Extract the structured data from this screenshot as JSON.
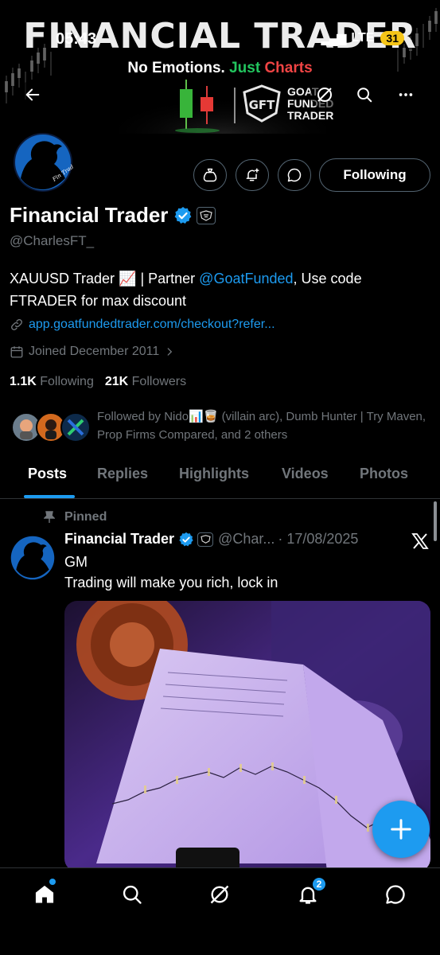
{
  "status_bar": {
    "time": "05:43",
    "network": "LTE",
    "battery": "31"
  },
  "banner": {
    "title": "FINANCIAL TRADER",
    "tagline_part1": "No Emotions.",
    "tagline_part2": "Just",
    "tagline_part3": "Charts",
    "brand_line1": "GOAT",
    "brand_line2": "FUNDED",
    "brand_line3": "TRADER",
    "brand_logo_text": "GFT"
  },
  "profile": {
    "display_name": "Financial Trader",
    "handle": "@CharlesFT_",
    "bio_part1": "XAUUSD Trader 📈 | Partner ",
    "bio_mention": "@GoatFunded",
    "bio_part2": ", Use code FTRADER for max discount",
    "website": "app.goatfundedtrader.com/checkout?refer...",
    "joined": "Joined December 2011",
    "following_count": "1.1K",
    "following_label": "Following",
    "followers_count": "21K",
    "followers_label": "Followers",
    "followed_by": "Followed by Nido📊🥃 (villain arc), Dumb Hunter | Try Maven, Prop Firms Compared, and 2 others",
    "following_button": "Following"
  },
  "tabs": [
    "Posts",
    "Replies",
    "Highlights",
    "Videos",
    "Photos"
  ],
  "pinned_post": {
    "pinned_label": "Pinned",
    "author": "Financial Trader",
    "handle": "@Char...",
    "date": "· 17/08/2025",
    "line1": "GM",
    "line2": "Trading will make you rich, lock in"
  },
  "bottom_nav": {
    "notifications_badge": "2"
  },
  "colors": {
    "accent": "#1d9bf0",
    "green": "#22c55e",
    "red": "#ef4444",
    "muted": "#71767b"
  }
}
